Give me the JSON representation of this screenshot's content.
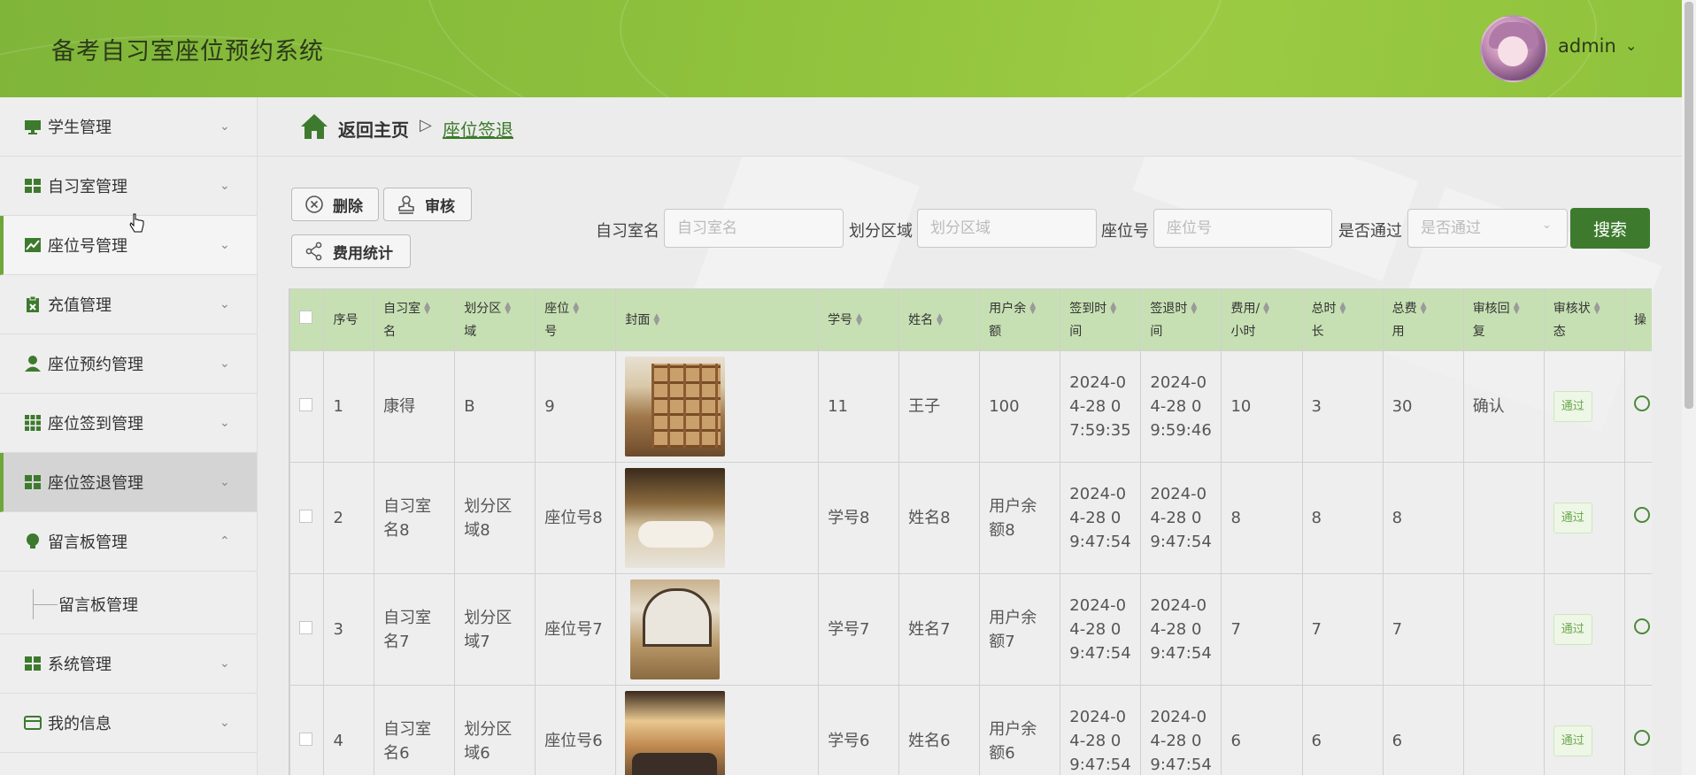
{
  "header": {
    "app_title": "备考自习室座位预约系统",
    "user_name": "admin",
    "caret": "⌄"
  },
  "sidebar": {
    "items": [
      {
        "label": "学生管理",
        "icon": "monitor-icon",
        "caret": "⌄"
      },
      {
        "label": "自习室管理",
        "icon": "grid-icon",
        "caret": "⌄"
      },
      {
        "label": "座位号管理",
        "icon": "chart-icon",
        "caret": "⌄"
      },
      {
        "label": "充值管理",
        "icon": "clipboard-icon",
        "caret": "⌄"
      },
      {
        "label": "座位预约管理",
        "icon": "user-icon",
        "caret": "⌄"
      },
      {
        "label": "座位签到管理",
        "icon": "grid-9-icon",
        "caret": "⌄"
      },
      {
        "label": "座位签退管理",
        "icon": "grid-icon",
        "caret": "⌄"
      },
      {
        "label": "留言板管理",
        "icon": "bulb-icon",
        "caret": "⌃"
      },
      {
        "label": "系统管理",
        "icon": "grid-icon",
        "caret": "⌄"
      },
      {
        "label": "我的信息",
        "icon": "card-icon",
        "caret": "⌄"
      }
    ],
    "submenu": {
      "label": "留言板管理"
    }
  },
  "breadcrumb": {
    "home": "返回主页",
    "separator": "▷",
    "current": "座位签退"
  },
  "toolbar": {
    "delete_label": "删除",
    "review_label": "审核",
    "stats_label": "费用统计"
  },
  "search": {
    "room_label": "自习室名",
    "room_placeholder": "自习室名",
    "area_label": "划分区域",
    "area_placeholder": "划分区域",
    "seat_label": "座位号",
    "seat_placeholder": "座位号",
    "pass_label": "是否通过",
    "pass_placeholder": "是否通过",
    "button_label": "搜索"
  },
  "table": {
    "columns": [
      {
        "line1": "序号",
        "line2": ""
      },
      {
        "line1": "自习室",
        "line2": "名"
      },
      {
        "line1": "划分区",
        "line2": "域"
      },
      {
        "line1": "座位",
        "line2": "号"
      },
      {
        "line1": "封面",
        "line2": ""
      },
      {
        "line1": "学号",
        "line2": ""
      },
      {
        "line1": "姓名",
        "line2": ""
      },
      {
        "line1": "用户余",
        "line2": "额"
      },
      {
        "line1": "签到时",
        "line2": "间"
      },
      {
        "line1": "签退时",
        "line2": "间"
      },
      {
        "line1": "费用/",
        "line2": "小时"
      },
      {
        "line1": "总时",
        "line2": "长"
      },
      {
        "line1": "总费",
        "line2": "用"
      },
      {
        "line1": "审核回",
        "line2": "复"
      },
      {
        "line1": "审核状",
        "line2": "态"
      },
      {
        "line1": "操",
        "line2": ""
      }
    ],
    "rows": [
      {
        "no": "1",
        "room": "康得",
        "area": "B",
        "seat": "9",
        "student_id": "11",
        "name": "王子",
        "balance": "100",
        "checkin": "2024-04-28 07:59:35",
        "checkout": "2024-04-28 09:59:46",
        "fee": "10",
        "hours": "3",
        "total": "30",
        "reply": "确认",
        "status": "通过"
      },
      {
        "no": "2",
        "room": "自习室名8",
        "area": "划分区域8",
        "seat": "座位号8",
        "student_id": "学号8",
        "name": "姓名8",
        "balance": "用户余额8",
        "checkin": "2024-04-28 09:47:54",
        "checkout": "2024-04-28 09:47:54",
        "fee": "8",
        "hours": "8",
        "total": "8",
        "reply": "",
        "status": "通过"
      },
      {
        "no": "3",
        "room": "自习室名7",
        "area": "划分区域7",
        "seat": "座位号7",
        "student_id": "学号7",
        "name": "姓名7",
        "balance": "用户余额7",
        "checkin": "2024-04-28 09:47:54",
        "checkout": "2024-04-28 09:47:54",
        "fee": "7",
        "hours": "7",
        "total": "7",
        "reply": "",
        "status": "通过"
      },
      {
        "no": "4",
        "room": "自习室名6",
        "area": "划分区域6",
        "seat": "座位号6",
        "student_id": "学号6",
        "name": "姓名6",
        "balance": "用户余额6",
        "checkin": "2024-04-28 09:47:54",
        "checkout": "2024-04-28 09:47:54",
        "fee": "6",
        "hours": "6",
        "total": "6",
        "reply": "",
        "status": "通过"
      }
    ]
  },
  "colors": {
    "accent": "#3d7a2e",
    "header_green": "#8dc03c",
    "table_header": "#c7e0b3",
    "status_green": "#6aa84f"
  }
}
